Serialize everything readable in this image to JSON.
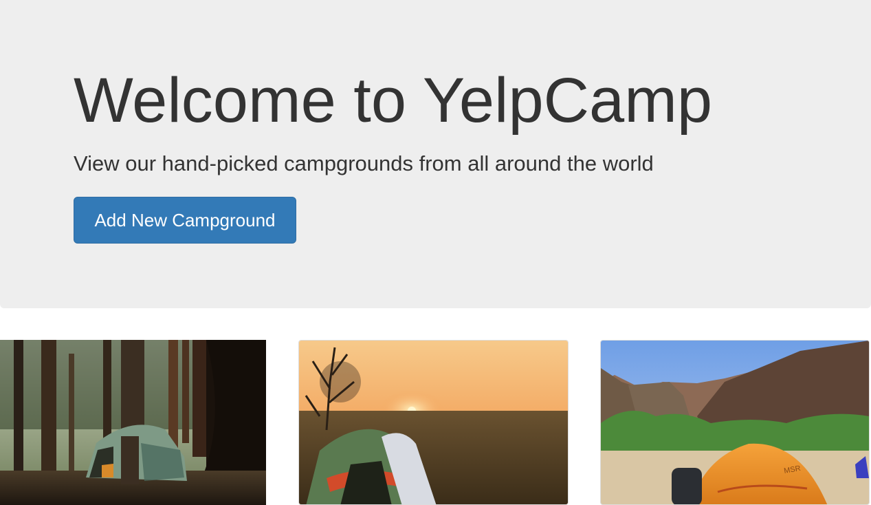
{
  "jumbotron": {
    "heading": "Welcome to YelpCamp",
    "subheading": "View our hand-picked campgrounds from all around the world",
    "button_label": "Add New Campground"
  },
  "campgrounds": [
    {
      "image": "tent-in-forest"
    },
    {
      "image": "tent-at-sunset"
    },
    {
      "image": "orange-msr-tent-in-canyon",
      "brand_text": "MSR"
    }
  ],
  "colors": {
    "jumbotron_bg": "#eeeeee",
    "primary": "#337ab7",
    "text": "#333333"
  }
}
